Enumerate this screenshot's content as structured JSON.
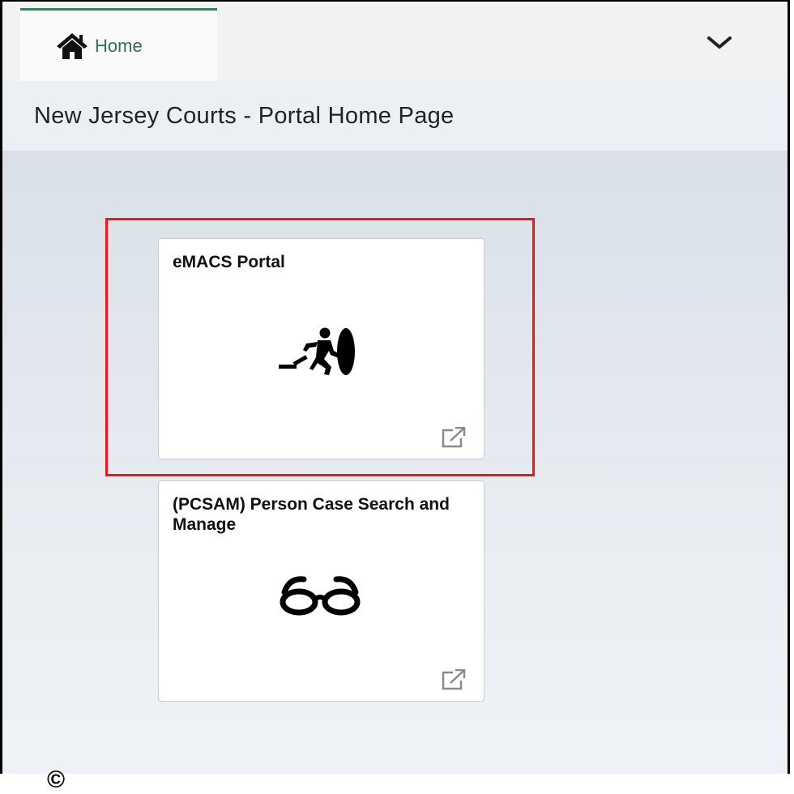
{
  "nav": {
    "home_label": "Home",
    "home_icon": "home-icon",
    "menu_icon": "chevron-down-icon",
    "accent_color": "#3c7f59"
  },
  "page": {
    "title": "New Jersey Courts - Portal Home Page"
  },
  "tiles": [
    {
      "title": "eMACS Portal",
      "icon": "running-exit-icon",
      "action_icon": "external-link-icon"
    },
    {
      "title": "(PCSAM) Person Case Search and Manage",
      "icon": "glasses-icon",
      "action_icon": "external-link-icon"
    }
  ],
  "annotation": {
    "color": "#ff1010"
  },
  "footer": {
    "symbol": "©"
  }
}
